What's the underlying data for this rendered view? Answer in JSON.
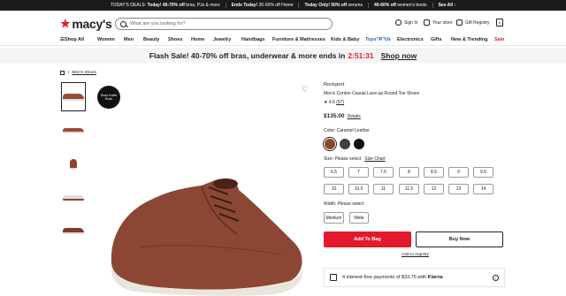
{
  "topbar": {
    "items": [
      {
        "prefix": "TODAY'S DEALS:",
        "bold": "Today! 40-70% off",
        "rest": " bras, PJs & more"
      },
      {
        "prefix": "",
        "bold": "Ends Today!",
        "rest": " 30-60% off Home"
      },
      {
        "prefix": "",
        "bold": "Today Only! 50% off",
        "rest": " serums"
      },
      {
        "prefix": "",
        "bold": "40-60% off",
        "rest": " women's boots"
      }
    ],
    "see_all": "See All"
  },
  "header": {
    "logo_text": "macy's",
    "search_placeholder": "What are you looking for?",
    "sign_in": "Sign In",
    "your_store": "Your store",
    "gift_registry": "Gift Registry",
    "bag_count": "0"
  },
  "nav": {
    "shop_all": "Shop All",
    "items": [
      "Women",
      "Men",
      "Beauty",
      "Shoes",
      "Home",
      "Jewelry",
      "Handbags",
      "Furniture & Mattresses",
      "Kids & Baby",
      "Toys\"R\"Us",
      "Electronics",
      "Gifts",
      "New & Trending",
      "Sale"
    ]
  },
  "flash": {
    "text": "Flash Sale! 40-70% off bras, underwear & more ends in",
    "timer": "2:51:31",
    "link": "Shop now"
  },
  "breadcrumb": {
    "sep": "/",
    "link": "Men's Shoes"
  },
  "badge": {
    "text": "Rock it with Rock"
  },
  "product": {
    "brand": "Rockport",
    "title": "Men's Conton Casual Lace-up Round Toe Shoes",
    "rating": "4.6",
    "rating_count": "(67)",
    "price": "$135.00",
    "details_link": "Details",
    "color_label": "Color: Caramel Leather",
    "colors": [
      {
        "name": "Caramel Leather",
        "hex": "#8b4733"
      },
      {
        "name": "Gray",
        "hex": "#3d4045"
      },
      {
        "name": "Black",
        "hex": "#111111"
      }
    ],
    "size_label": "Size: Please select",
    "size_chart": "Size Chart",
    "sizes": [
      "6.5",
      "7",
      "7.5",
      "8",
      "8.5",
      "9",
      "9.5",
      "10",
      "10.5",
      "11",
      "11.5",
      "12",
      "13",
      "14"
    ],
    "width_label": "Width: Please select",
    "widths": [
      "Medium",
      "Wide"
    ],
    "add_to_bag": "Add To Bag",
    "buy_now": "Buy Now",
    "add_registry": "Add to registry",
    "klarna_text": "4 interest-free payments of $33.75 with",
    "klarna_brand": "Klarna"
  },
  "colors": {
    "brand_red": "#e21a2c",
    "leather": "#8b4733"
  }
}
